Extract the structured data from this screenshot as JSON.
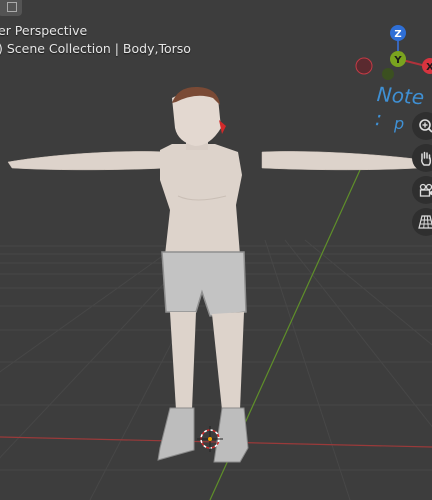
{
  "viewport": {
    "mode_label": "er Perspective",
    "collection_label": ") Scene Collection | Body,Torso"
  },
  "gizmo": {
    "z_label": "Z",
    "y_label": "Y",
    "x_label": "X",
    "z_color": "#2f6fd6",
    "y_color": "#7aa31f",
    "x_color": "#d8343f"
  },
  "annotation": {
    "note_line1": "Note :",
    "note_line2": "p"
  },
  "icons": {
    "zoom": "zoom-in-icon",
    "pan": "hand-pan-icon",
    "camera": "camera-icon",
    "perspective": "grid-perspective-icon"
  },
  "colors": {
    "background": "#3d3d3d",
    "x_axis_line": "#9a3a3a",
    "y_axis_line": "#5f8f2a"
  }
}
